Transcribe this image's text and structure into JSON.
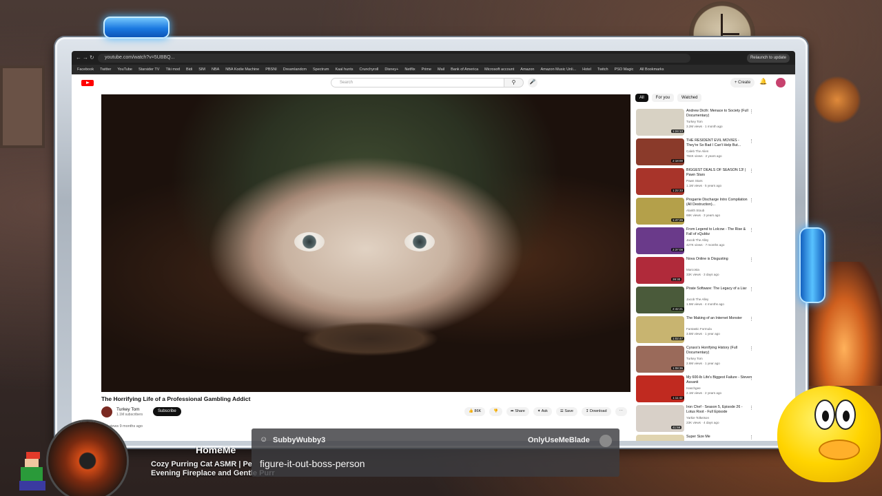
{
  "browser": {
    "url": "youtube.com/watch?v=5UBBQ...",
    "relaunch_label": "Relaunch to update",
    "bookmarks": [
      "Facebook",
      "Twitter",
      "YouTube",
      "Starsider TV",
      "Tiki mod",
      "Bidi",
      "SIM",
      "NBA",
      "NBA Kodie Machine",
      "PBSNI",
      "Dreamlandcm",
      "Spectrum",
      "Kaal hunts",
      "Crunchyroll",
      "Disney+",
      "Netflix",
      "Prime",
      "Mail",
      "Bank of America",
      "Microsoft account",
      "Amazon",
      "Amazon Music Unli...",
      "Hotel",
      "Twitch",
      "PSO Magic",
      "All Bookmarks"
    ]
  },
  "youtube": {
    "search_placeholder": "Search",
    "create_label": "+ Create",
    "video": {
      "title": "The Horrifying Life of a Professional Gambling Addict",
      "channel": "Turkey Tom",
      "subscribers": "1.1M subscribers",
      "subscribe_label": "Subscribe",
      "likes": "86K",
      "share_label": "Share",
      "ask_label": "Ask",
      "save_label": "Save",
      "download_label": "Download",
      "description": "36K views  9 months ago"
    },
    "chips": [
      "All",
      "For you",
      "Watched"
    ],
    "recommendations": [
      {
        "title": "Andrew Dicth: Menace to Society (Full Documentary)",
        "channel": "Turkey Tom",
        "meta": "3.2M views · 1 month ago",
        "duration": "1:24:13",
        "color": "#d8d2c4"
      },
      {
        "title": "THE RESIDENT EVIL MOVIES - They're So Bad I Can't Help But...",
        "channel": "Caleb The Alien",
        "meta": "784K views · 2 years ago",
        "duration": "2:18:00",
        "color": "#8a3a2a"
      },
      {
        "title": "BIGGEST DEALS OF SEASON 13! | Pawn Stars",
        "channel": "Pawn Stars",
        "meta": "1.1M views · 5 years ago",
        "duration": "1:22:33",
        "color": "#a8342a"
      },
      {
        "title": "Progarrie Discharge Intro Compilation (All Destruction)...",
        "channel": "Alarith Stoub",
        "meta": "68K views · 3 years ago",
        "duration": "1:47:26",
        "color": "#b4a04a"
      },
      {
        "title": "From Legend to Lolcow - The Rise & Fall of xQubbz",
        "channel": "Jacob The Alley",
        "meta": "427K views · 7 months ago",
        "duration": "2:37:08",
        "color": "#6a3a8a"
      },
      {
        "title": "Nova Online is Disgusting",
        "channel": "Marcosta",
        "meta": "33K views · 3 days ago",
        "duration": "28:30",
        "color": "#b02a3a"
      },
      {
        "title": "Pirate Software: The Legacy of a Liar",
        "channel": "Jacob The Alley",
        "meta": "1.5M views · 4 months ago",
        "duration": "2:42:21",
        "color": "#4a5a3a"
      },
      {
        "title": "The Making of an Internet Monster",
        "channel": "Fantastic Formula",
        "meta": "3.5M views · 1 year ago",
        "duration": "1:02:47",
        "color": "#c8b470"
      },
      {
        "title": "Cyraxx's Horrifying History (Full Documentary)",
        "channel": "Turkey Tom",
        "meta": "2.6M views · 1 year ago",
        "duration": "1:08:36",
        "color": "#9a6a5a"
      },
      {
        "title": "My 600-lb Life's Biggest Failure - Steven Assanti",
        "channel": "Haschgee",
        "meta": "2.1M views · 2 years ago",
        "duration": "1:11:42",
        "color": "#c02a20"
      },
      {
        "title": "Iron Chef - Season 5, Episode 26 - Lotus Root - Full Episode",
        "channel": "Yarkie Tolkeison",
        "meta": "23K views · 4 days ago",
        "duration": "41:56",
        "color": "#d8d0c8"
      },
      {
        "title": "Super Size Me",
        "channel": "",
        "meta": "",
        "duration": "",
        "color": "#e0d4b0"
      }
    ]
  },
  "overlay": {
    "chat": {
      "username": "SubbyWubby3",
      "right_user": "OnlyUseMeBlade",
      "message": "figure-it-out-boss-person"
    },
    "music": {
      "label": "HomeMe",
      "song_line1": "Cozy Purring Cat ASMR | Pe",
      "song_line2": "Evening Fireplace and Gentle Purr"
    }
  }
}
